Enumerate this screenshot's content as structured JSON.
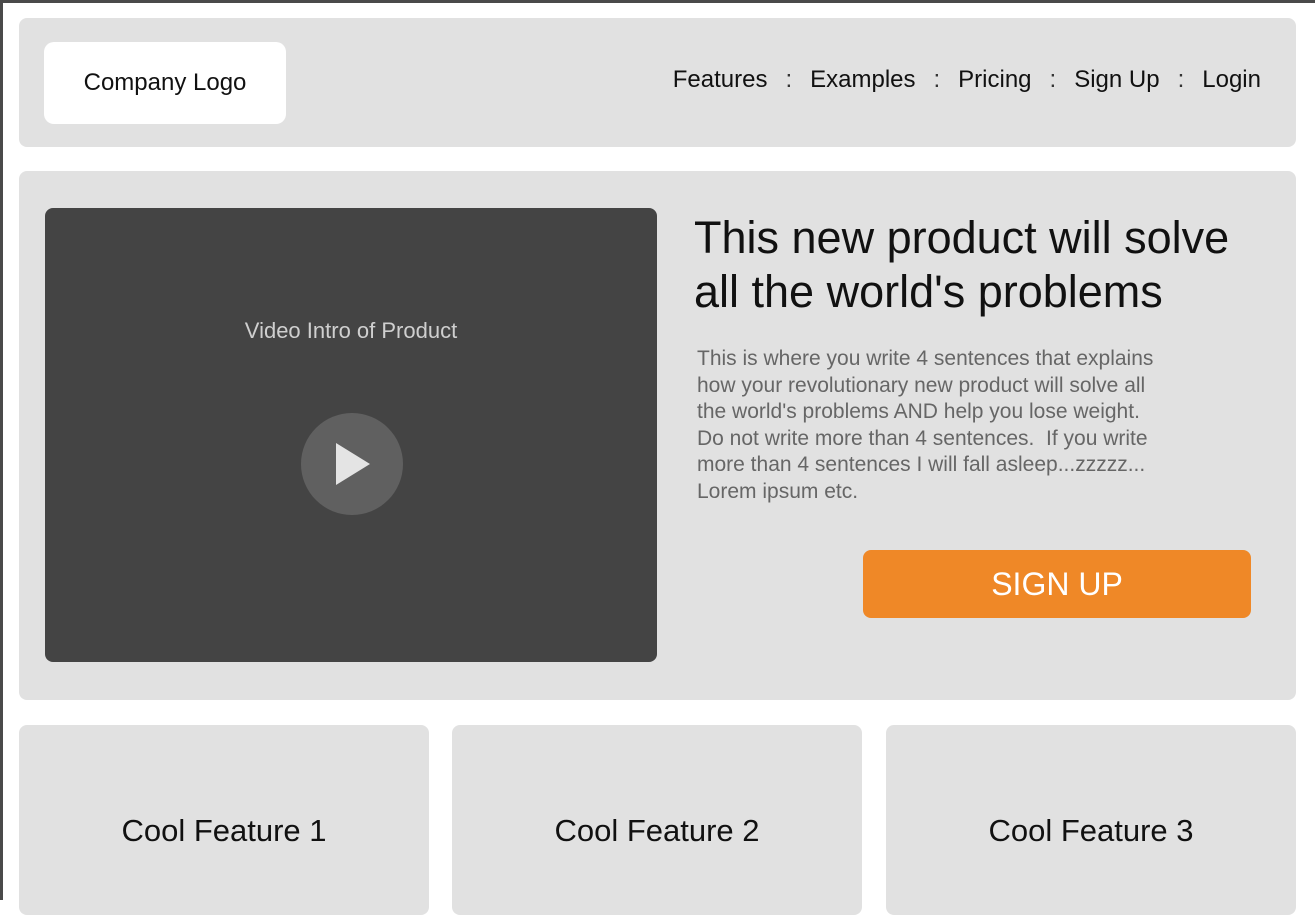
{
  "header": {
    "logo_text": "Company Logo",
    "nav": [
      {
        "label": "Features"
      },
      {
        "label": "Examples"
      },
      {
        "label": "Pricing"
      },
      {
        "label": "Sign Up"
      },
      {
        "label": "Login"
      }
    ],
    "separator": ":"
  },
  "hero": {
    "video_title": "Video Intro of Product",
    "headline": "This new product will solve all the world's problems",
    "description": "This is where you write 4 sentences that explains\nhow your revolutionary new product will solve all\nthe world's problems AND help you lose weight.\nDo not write more than 4 sentences.  If you write\nmore than 4 sentences I will fall asleep...zzzzz...\nLorem ipsum etc.",
    "cta_label": "SIGN UP"
  },
  "features": [
    {
      "title": "Cool Feature 1"
    },
    {
      "title": "Cool Feature 2"
    },
    {
      "title": "Cool Feature 3"
    }
  ],
  "colors": {
    "panel": "#e1e1e1",
    "video_bg": "#444444",
    "cta": "#ef8827",
    "body_text": "#666666"
  },
  "icons": {
    "play": "play-icon"
  }
}
